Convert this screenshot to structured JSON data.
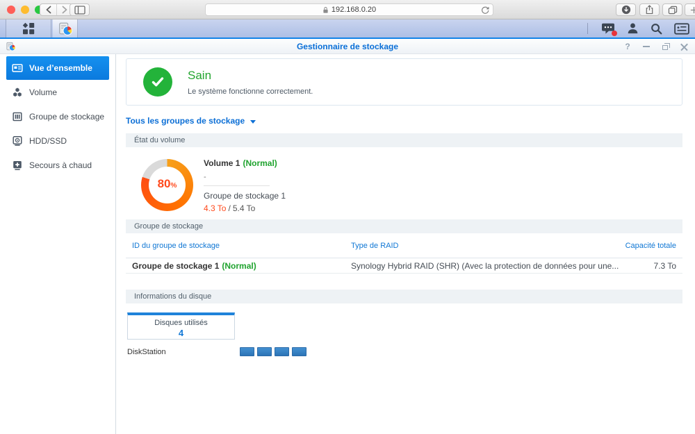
{
  "browser": {
    "address": "192.168.0.20"
  },
  "taskbar": {
    "icons": [
      "main-menu",
      "storage-manager",
      "notifications-chat",
      "user",
      "search",
      "widgets"
    ]
  },
  "window": {
    "title": "Gestionnaire de stockage",
    "controls": {
      "help": "?"
    },
    "sidebar": [
      {
        "label": "Vue d’ensemble",
        "active": true
      },
      {
        "label": "Volume",
        "active": false
      },
      {
        "label": "Groupe de stockage",
        "active": false
      },
      {
        "label": "HDD/SSD",
        "active": false
      },
      {
        "label": "Secours à chaud",
        "active": false
      }
    ],
    "main": {
      "health": {
        "status": "Sain",
        "description": "Le système fonctionne correctement."
      },
      "filter_label": "Tous les groupes de stockage",
      "volume_section": {
        "header": "État du volume",
        "percent": 80,
        "percent_text": "80",
        "percent_unit": "%",
        "volume_name": "Volume 1",
        "volume_status": "(Normal)",
        "detail_placeholder": "-",
        "group_name": "Groupe de stockage 1",
        "used": "4.3 To",
        "separator": "/",
        "total": "5.4 To"
      },
      "pool_section": {
        "header": "Groupe de stockage",
        "columns": {
          "id": "ID du groupe de stockage",
          "raid": "Type de RAID",
          "capacity": "Capacité totale"
        },
        "row": {
          "id": "Groupe de stockage 1",
          "status": "(Normal)",
          "raid": "Synology Hybrid RAID (SHR) (Avec la protection de données pour une...",
          "capacity": "7.3 To"
        }
      },
      "disk_section": {
        "header": "Informations du disque",
        "tab_label": "Disques utilisés",
        "tab_count": "4",
        "host": "DiskStation",
        "disk_count": 4
      }
    }
  },
  "colors": {
    "accent_blue": "#0c84e4",
    "title_blue": "#0a6fd7",
    "health_green": "#23b33a",
    "status_green": "#1fa32e",
    "used_orange": "#ff4a1d",
    "donut_start": "#f7a01b",
    "donut_mid": "#ff7300",
    "donut_end": "#ff4d12",
    "donut_rest": "#dadada",
    "taskbar_line": "#1283e8",
    "disk_bar": "#2e7dc2"
  }
}
